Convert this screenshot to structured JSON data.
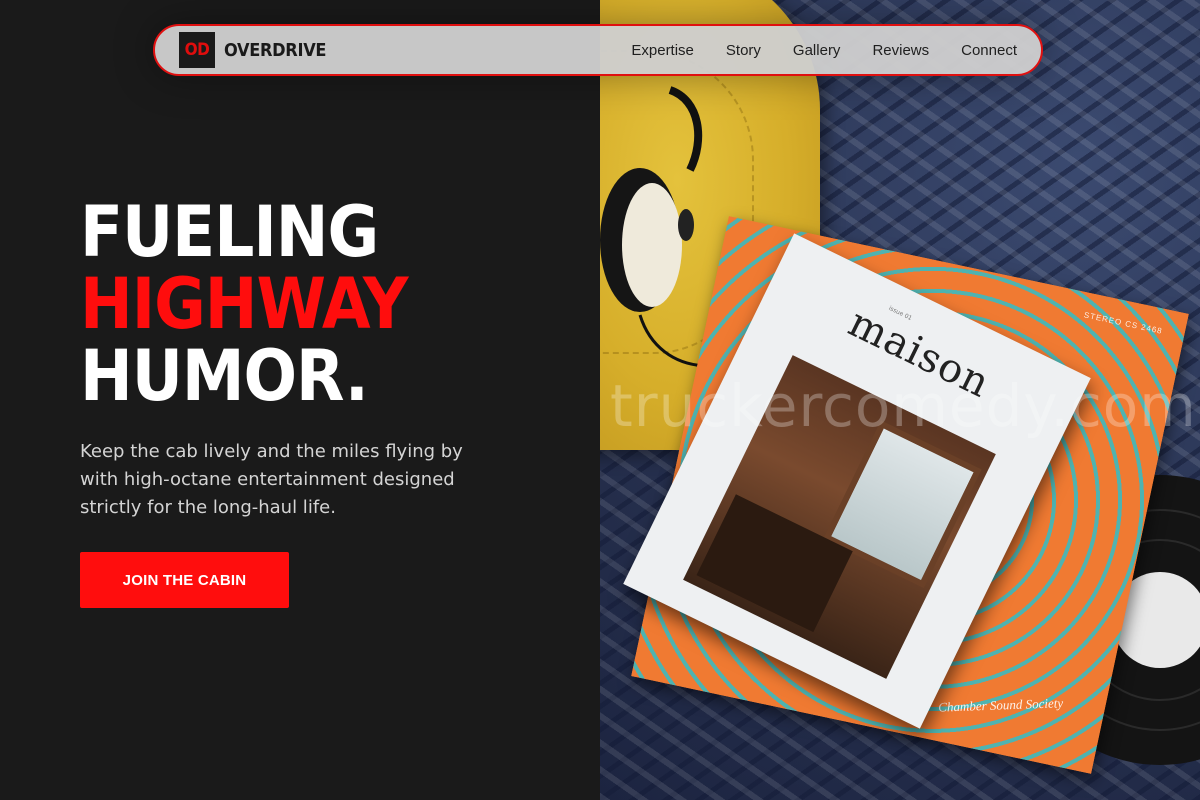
{
  "nav": {
    "logo_mark": "OD",
    "brand": "OVERDRIVE",
    "links": [
      "Expertise",
      "Story",
      "Gallery",
      "Reviews",
      "Connect"
    ]
  },
  "hero": {
    "headline_line1": "FUELING",
    "headline_line2": "HIGHWAY",
    "headline_line3": "HUMOR.",
    "subtext": "Keep the cab lively and the miles flying by with high-octane entertainment designed strictly for the long-haul life.",
    "cta_label": "JOIN THE CABIN"
  },
  "photo": {
    "magazine_title": "maison",
    "magazine_issue": "issue 01",
    "sleeve_label": "STEREO CS 2468",
    "sleeve_signature": "Chamber Sound Society",
    "watermark": "truckercomedy.com"
  },
  "colors": {
    "accent": "#ff0d0d",
    "background": "#1a1a1a",
    "nav_background": "#cecece",
    "nav_border": "#e01010"
  }
}
